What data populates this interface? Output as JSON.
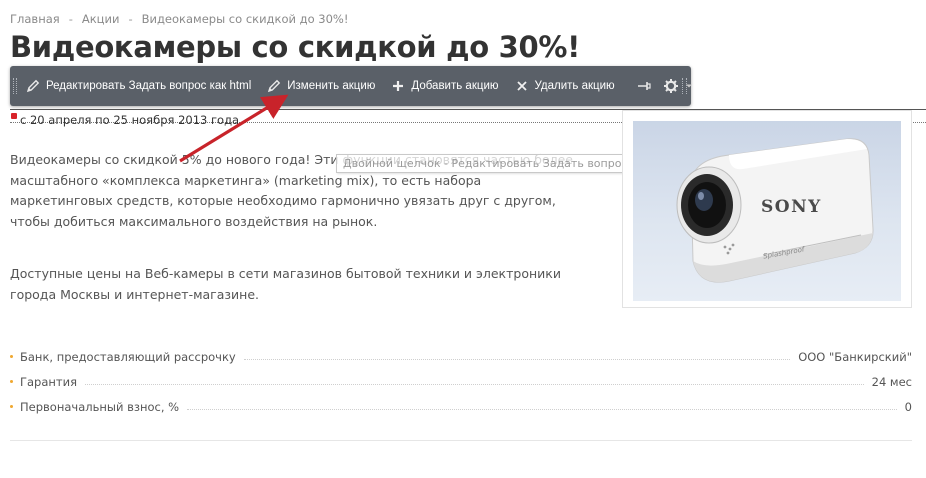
{
  "breadcrumb": {
    "items": [
      "Главная",
      "Акции",
      "Видеокамеры со скидкой до 30%!"
    ],
    "separator": "-"
  },
  "page": {
    "title": "Видеокамеры со скидкой до 30%!"
  },
  "toolbar": {
    "edit_label": "Редактировать Задать вопрос как html",
    "change_label": "Изменить акцию",
    "add_label": "Добавить акцию",
    "delete_label": "Удалить акцию",
    "icons": [
      "pencil-icon",
      "pencil-icon",
      "plus-icon",
      "close-icon",
      "pin-icon",
      "gear-icon",
      "caret-down-icon"
    ],
    "background_color": "#5a6068"
  },
  "promo": {
    "dates": "с 20 апреля по 25 ноября 2013 года.",
    "paragraph1": "Видеокамеры со скидкой 5% до нового года! Эти функции становятся частью более масштабного «комплекса маркетинга» (marketing mix), то есть набора маркетинговых средств, которые необходимо гармонично увязать друг с другом, чтобы добиться максимального воздействия на рынок.",
    "paragraph2": "Доступные цены на Веб-камеры в сети магазинов бытовой техники и электроники города Москвы и интернет-магазине."
  },
  "tooltip": {
    "text": "Двойной щелчок - Редактировать Задать вопрос как html"
  },
  "product": {
    "brand": "SONY",
    "model_marks": "Splashproof"
  },
  "specs": [
    {
      "name": "Банк, предоставляющий рассрочку",
      "value": "ООО \"Банкирский\""
    },
    {
      "name": "Гарантия",
      "value": "24 мес"
    },
    {
      "name": "Первоначальный взнос, %",
      "value": "0"
    }
  ],
  "colors": {
    "accent_bullet": "#f0a830",
    "annotation_arrow": "#c8232a"
  }
}
